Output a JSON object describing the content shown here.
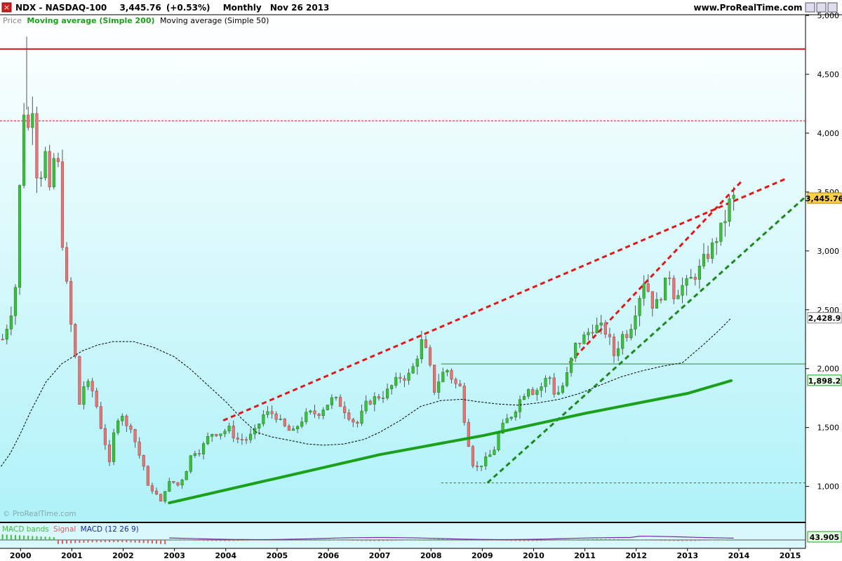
{
  "header": {
    "symbol": "NDX - NASDAQ-100",
    "last": "3,445.76",
    "change": "(+0.53%)",
    "period": "Monthly",
    "date": "Nov 26 2013",
    "site": "www.ProRealTime.com",
    "watermark": "© ProRealTime.com"
  },
  "legend": {
    "price": "Price",
    "ma200": "Moving average (Simple 200)",
    "ma50": "Moving average (Simple 50)"
  },
  "macd_legend": {
    "bands": "MACD bands",
    "signal": "Signal",
    "macd": "MACD (12 26 9)"
  },
  "colors": {
    "up": "#3cbf3c",
    "down": "#e07878",
    "ma200": "#1aa01a",
    "trend_red": "#e01818",
    "trend_green": "#1a8a1a",
    "resistance": "#d01c1c",
    "bg_top": "#ffffff",
    "bg_bottom": "#aef2f8"
  },
  "chart_data": {
    "type": "candlestick",
    "title": "NDX - NASDAQ-100",
    "x_range": [
      1999.6,
      2015.3
    ],
    "y_range": [
      700,
      5000
    ],
    "x_ticks": [
      "2000",
      "2001",
      "2002",
      "2003",
      "2004",
      "2005",
      "2006",
      "2007",
      "2008",
      "2009",
      "2010",
      "2011",
      "2012",
      "2013",
      "2014",
      "2015"
    ],
    "y_ticks": [
      "1,000",
      "1,500",
      "2,000",
      "2,500",
      "3,000",
      "3,500",
      "4,000",
      "4,500",
      "5,000"
    ],
    "y_tick_values": [
      1000,
      1500,
      2000,
      2500,
      3000,
      3500,
      4000,
      4500,
      5000
    ],
    "last_label": "3,445.76",
    "ma50_label": "2,428.9",
    "ma200_label": "1,898.2",
    "macd_label": "43.905",
    "anchors": [
      [
        1999.65,
        2250
      ],
      [
        1999.8,
        2450
      ],
      [
        1999.9,
        2700
      ],
      [
        2000.0,
        3700
      ],
      [
        2000.08,
        4300
      ],
      [
        2000.16,
        4000
      ],
      [
        2000.25,
        4300
      ],
      [
        2000.33,
        3550
      ],
      [
        2000.42,
        3700
      ],
      [
        2000.5,
        3850
      ],
      [
        2000.58,
        3400
      ],
      [
        2000.7,
        4050
      ],
      [
        2000.78,
        3250
      ],
      [
        2000.9,
        2700
      ],
      [
        2001.0,
        2300
      ],
      [
        2001.08,
        2050
      ],
      [
        2001.16,
        1650
      ],
      [
        2001.25,
        1900
      ],
      [
        2001.33,
        1850
      ],
      [
        2001.42,
        1800
      ],
      [
        2001.5,
        1650
      ],
      [
        2001.58,
        1480
      ],
      [
        2001.66,
        1350
      ],
      [
        2001.75,
        1150
      ],
      [
        2001.83,
        1500
      ],
      [
        2001.95,
        1650
      ],
      [
        2002.0,
        1600
      ],
      [
        2002.08,
        1480
      ],
      [
        2002.16,
        1520
      ],
      [
        2002.25,
        1350
      ],
      [
        2002.33,
        1250
      ],
      [
        2002.42,
        1150
      ],
      [
        2002.5,
        950
      ],
      [
        2002.58,
        980
      ],
      [
        2002.66,
        920
      ],
      [
        2002.75,
        850
      ],
      [
        2002.83,
        1000
      ],
      [
        2002.95,
        1050
      ],
      [
        2003.05,
        1000
      ],
      [
        2003.2,
        1100
      ],
      [
        2003.35,
        1300
      ],
      [
        2003.5,
        1300
      ],
      [
        2003.7,
        1450
      ],
      [
        2003.95,
        1460
      ],
      [
        2004.05,
        1500
      ],
      [
        2004.2,
        1400
      ],
      [
        2004.4,
        1400
      ],
      [
        2004.55,
        1450
      ],
      [
        2004.75,
        1620
      ],
      [
        2004.95,
        1620
      ],
      [
        2005.1,
        1520
      ],
      [
        2005.3,
        1450
      ],
      [
        2005.45,
        1550
      ],
      [
        2005.6,
        1620
      ],
      [
        2005.8,
        1620
      ],
      [
        2005.95,
        1690
      ],
      [
        2006.1,
        1750
      ],
      [
        2006.25,
        1690
      ],
      [
        2006.4,
        1600
      ],
      [
        2006.55,
        1520
      ],
      [
        2006.75,
        1710
      ],
      [
        2006.95,
        1760
      ],
      [
        2007.1,
        1780
      ],
      [
        2007.25,
        1860
      ],
      [
        2007.4,
        1930
      ],
      [
        2007.55,
        1930
      ],
      [
        2007.7,
        2050
      ],
      [
        2007.8,
        2240
      ],
      [
        2007.95,
        2100
      ],
      [
        2008.05,
        1800
      ],
      [
        2008.2,
        1950
      ],
      [
        2008.35,
        2000
      ],
      [
        2008.45,
        1850
      ],
      [
        2008.55,
        1900
      ],
      [
        2008.62,
        1650
      ],
      [
        2008.72,
        1400
      ],
      [
        2008.8,
        1200
      ],
      [
        2008.92,
        1150
      ],
      [
        2009.0,
        1200
      ],
      [
        2009.12,
        1250
      ],
      [
        2009.22,
        1300
      ],
      [
        2009.32,
        1450
      ],
      [
        2009.45,
        1550
      ],
      [
        2009.6,
        1620
      ],
      [
        2009.75,
        1750
      ],
      [
        2009.9,
        1850
      ],
      [
        2010.0,
        1800
      ],
      [
        2010.15,
        1850
      ],
      [
        2010.3,
        1950
      ],
      [
        2010.4,
        1800
      ],
      [
        2010.5,
        1800
      ],
      [
        2010.62,
        1900
      ],
      [
        2010.72,
        2050
      ],
      [
        2010.82,
        2200
      ],
      [
        2010.95,
        2250
      ],
      [
        2011.05,
        2300
      ],
      [
        2011.15,
        2350
      ],
      [
        2011.3,
        2350
      ],
      [
        2011.45,
        2300
      ],
      [
        2011.55,
        2100
      ],
      [
        2011.65,
        2200
      ],
      [
        2011.75,
        2300
      ],
      [
        2011.85,
        2300
      ],
      [
        2011.95,
        2450
      ],
      [
        2012.05,
        2600
      ],
      [
        2012.15,
        2750
      ],
      [
        2012.25,
        2650
      ],
      [
        2012.35,
        2500
      ],
      [
        2012.45,
        2600
      ],
      [
        2012.55,
        2700
      ],
      [
        2012.65,
        2800
      ],
      [
        2012.75,
        2600
      ],
      [
        2012.85,
        2700
      ],
      [
        2012.95,
        2700
      ],
      [
        2013.05,
        2750
      ],
      [
        2013.15,
        2800
      ],
      [
        2013.25,
        2850
      ],
      [
        2013.35,
        2950
      ],
      [
        2013.45,
        3000
      ],
      [
        2013.55,
        3100
      ],
      [
        2013.62,
        3150
      ],
      [
        2013.72,
        3250
      ],
      [
        2013.8,
        3400
      ],
      [
        2013.9,
        3446
      ]
    ],
    "ma50": [
      [
        1999.62,
        1170
      ],
      [
        1999.8,
        1280
      ],
      [
        2000.0,
        1450
      ],
      [
        2000.2,
        1640
      ],
      [
        2000.5,
        1890
      ],
      [
        2000.8,
        2040
      ],
      [
        2001.2,
        2150
      ],
      [
        2001.5,
        2200
      ],
      [
        2001.8,
        2230
      ],
      [
        2002.2,
        2230
      ],
      [
        2002.6,
        2180
      ],
      [
        2003.0,
        2100
      ],
      [
        2003.3,
        2000
      ],
      [
        2003.6,
        1880
      ],
      [
        2004.0,
        1720
      ],
      [
        2004.3,
        1580
      ],
      [
        2004.6,
        1460
      ],
      [
        2004.9,
        1420
      ],
      [
        2005.2,
        1395
      ],
      [
        2005.6,
        1360
      ],
      [
        2005.9,
        1350
      ],
      [
        2006.3,
        1360
      ],
      [
        2006.7,
        1400
      ],
      [
        2007.0,
        1460
      ],
      [
        2007.4,
        1560
      ],
      [
        2007.8,
        1680
      ],
      [
        2008.2,
        1730
      ],
      [
        2008.6,
        1740
      ],
      [
        2008.9,
        1720
      ],
      [
        2009.3,
        1700
      ],
      [
        2009.7,
        1690
      ],
      [
        2010.1,
        1710
      ],
      [
        2010.5,
        1740
      ],
      [
        2010.9,
        1790
      ],
      [
        2011.3,
        1860
      ],
      [
        2011.7,
        1930
      ],
      [
        2012.1,
        1980
      ],
      [
        2012.5,
        2020
      ],
      [
        2012.9,
        2050
      ],
      [
        2013.3,
        2200
      ],
      [
        2013.6,
        2320
      ],
      [
        2013.85,
        2428.9
      ]
    ],
    "ma200": [
      [
        2002.9,
        860
      ],
      [
        2005.0,
        1070
      ],
      [
        2007.0,
        1270
      ],
      [
        2009.0,
        1430
      ],
      [
        2011.0,
        1620
      ],
      [
        2013.0,
        1790
      ],
      [
        2013.85,
        1898.2
      ]
    ],
    "lines": [
      {
        "name": "resistance-solid",
        "from": [
          1999.6,
          4715
        ],
        "to": [
          2015.3,
          4715
        ]
      },
      {
        "name": "resistance-dashed",
        "from": [
          1999.6,
          4105
        ],
        "to": [
          2015.3,
          4105
        ]
      },
      {
        "name": "support-2000",
        "from": [
          2008.2,
          2040
        ],
        "to": [
          2015.3,
          2040
        ]
      },
      {
        "name": "support-1000",
        "from": [
          2008.2,
          1030
        ],
        "to": [
          2015.3,
          1030
        ]
      },
      {
        "name": "red-channel-long",
        "from": [
          2003.95,
          1560
        ],
        "to": [
          2014.9,
          3610
        ]
      },
      {
        "name": "red-channel-steep",
        "from": [
          2010.7,
          2050
        ],
        "to": [
          2014.05,
          3590
        ]
      },
      {
        "name": "green-channel",
        "from": [
          2009.1,
          1030
        ],
        "to": [
          2015.3,
          3460
        ]
      }
    ]
  }
}
